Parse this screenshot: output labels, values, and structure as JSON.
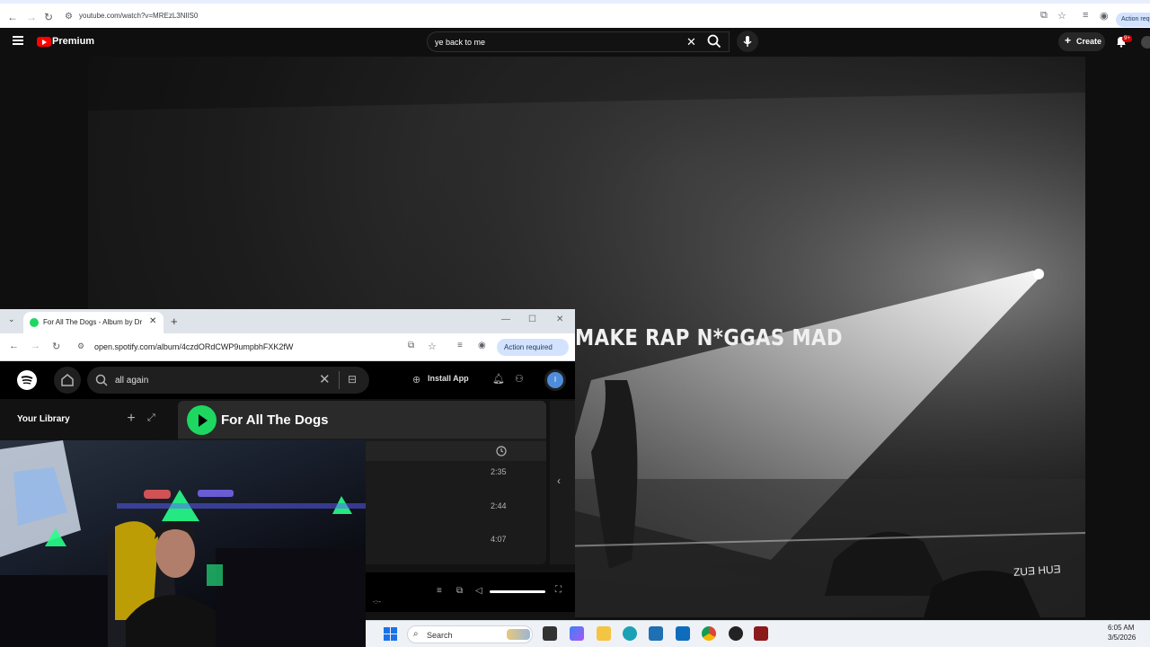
{
  "browser_top": {
    "url": "youtube.com/watch?v=MREzL3NIlS0",
    "action_required": "Action requir"
  },
  "youtube": {
    "brand": "Premium",
    "search_query": "ye back to me",
    "create_label": "Create",
    "notification_badge": "9+",
    "lyric_text": "MAKE RAP N*GGAS MAD",
    "watermark": "ZUƎ HUƎ"
  },
  "spotify_window": {
    "tab_title": "For All The Dogs - Album by Dr",
    "url": "open.spotify.com/album/4czdORdCWP9umpbhFXK2fW",
    "action_required": "Action required",
    "search_value": "all again",
    "install_app": "Install App",
    "avatar_initial": "I",
    "library_title": "Your Library",
    "album_title": "For All The Dogs",
    "durations": [
      "2:35",
      "2:44",
      "4:07"
    ],
    "player_time": "-:--"
  },
  "taskbar": {
    "search_placeholder": "Search",
    "time": "6:05 AM",
    "date": "3/5/2026"
  },
  "colors": {
    "spotify_green": "#1ed760",
    "youtube_red": "#ff0000",
    "action_pill": "#d3e3fd"
  }
}
